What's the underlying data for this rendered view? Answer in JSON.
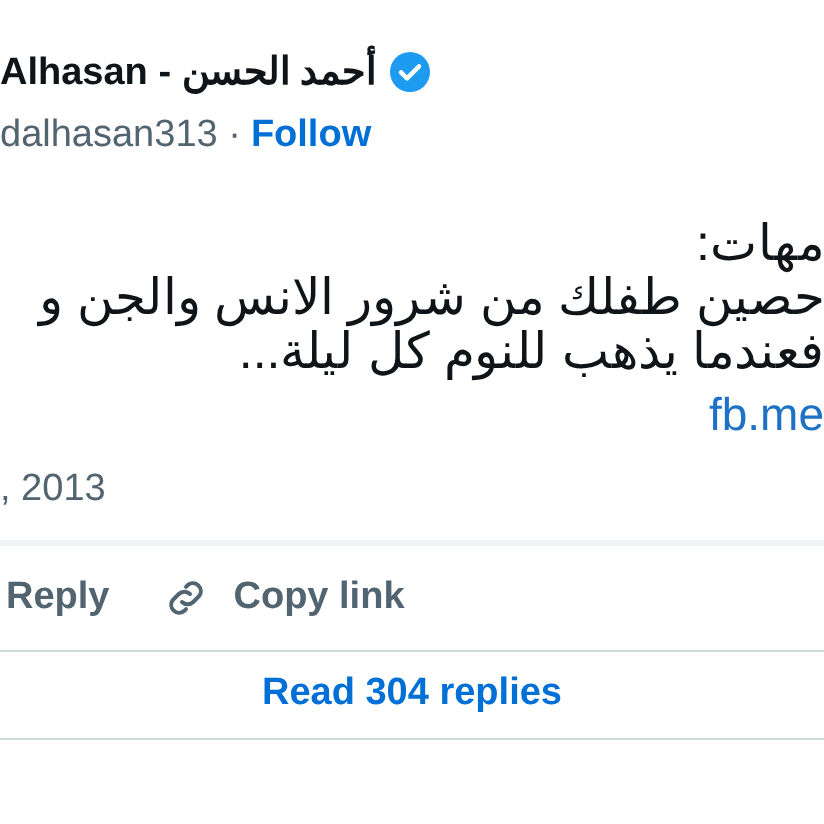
{
  "author": {
    "name": "Alhasan - أحمد الحسن",
    "verified": true,
    "handle": "dalhasan313 ·",
    "follow": "Follow"
  },
  "body": {
    "lines": [
      "مهات:",
      "حصين طفلك من شرور الانس والجن و",
      "فعندما يذهب للنوم كل ليلة..."
    ],
    "link": "fb.me"
  },
  "date": ", 2013",
  "reply_action": {
    "label": "Reply"
  },
  "copy_link_action": {
    "label": "Copy link"
  },
  "read_replies": "Read 304 replies"
}
